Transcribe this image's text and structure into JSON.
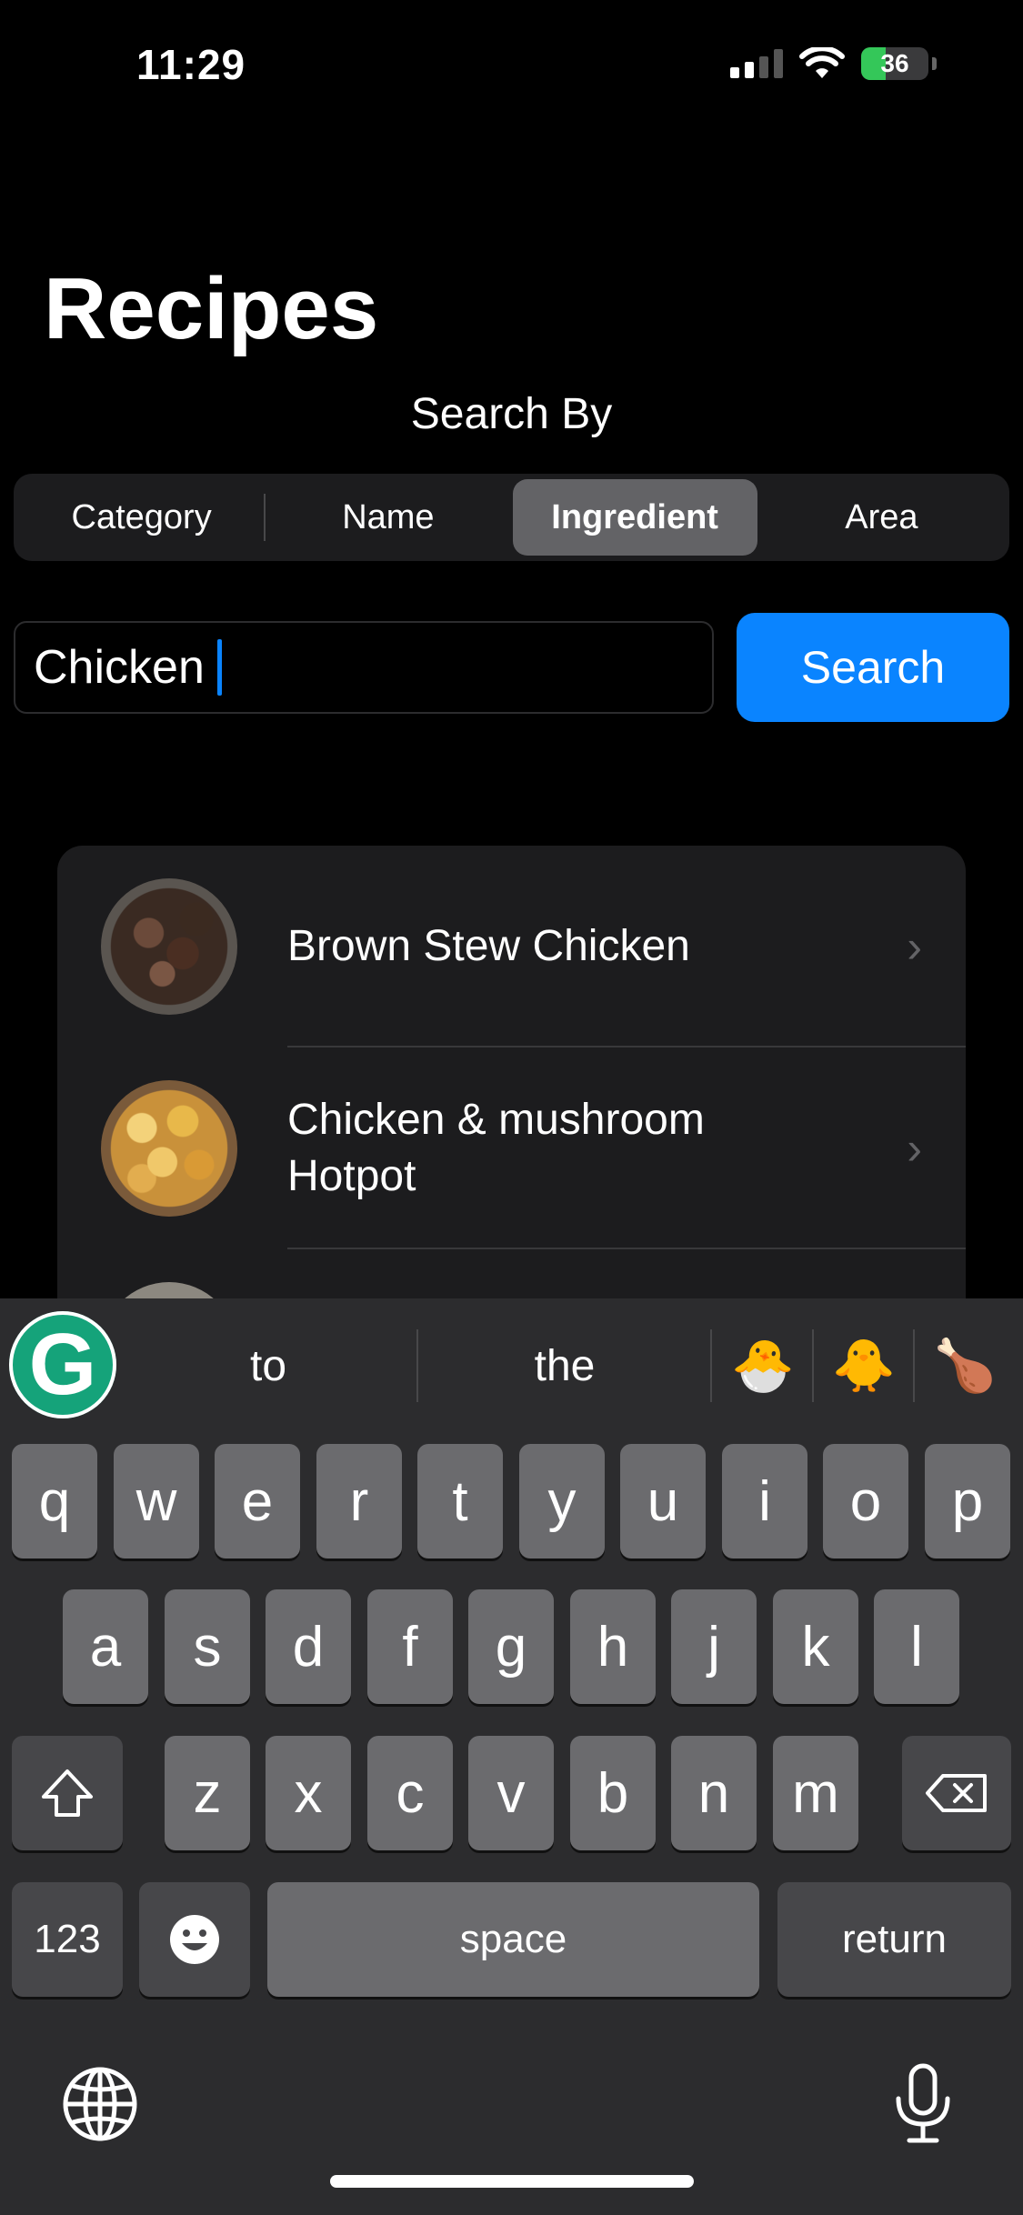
{
  "status_bar": {
    "time": "11:29",
    "battery_level": "36",
    "battery_fraction": 0.36
  },
  "header": {
    "title": "Recipes",
    "search_by_label": "Search By"
  },
  "segments": [
    {
      "label": "Category",
      "active": false
    },
    {
      "label": "Name",
      "active": false
    },
    {
      "label": "Ingredient",
      "active": true
    },
    {
      "label": "Area",
      "active": false
    }
  ],
  "search": {
    "value": "Chicken",
    "button_label": "Search"
  },
  "results": [
    {
      "name": "Brown Stew Chicken",
      "line2": ""
    },
    {
      "name": "Chicken & mushroom",
      "line2": "Hotpot"
    }
  ],
  "keyboard": {
    "suggestions": [
      "to",
      "the"
    ],
    "emoji_suggestions": [
      "🐣",
      "🐥",
      "🍗"
    ],
    "row1": [
      "q",
      "w",
      "e",
      "r",
      "t",
      "y",
      "u",
      "i",
      "o",
      "p"
    ],
    "row2": [
      "a",
      "s",
      "d",
      "f",
      "g",
      "h",
      "j",
      "k",
      "l"
    ],
    "row3": [
      "z",
      "x",
      "c",
      "v",
      "b",
      "n",
      "m"
    ],
    "numbers_key": "123",
    "space_key": "space",
    "return_key": "return",
    "grammarly_letter": "G"
  },
  "colors": {
    "accent": "#0a84ff",
    "background": "#000000",
    "card": "#1c1c1e"
  }
}
